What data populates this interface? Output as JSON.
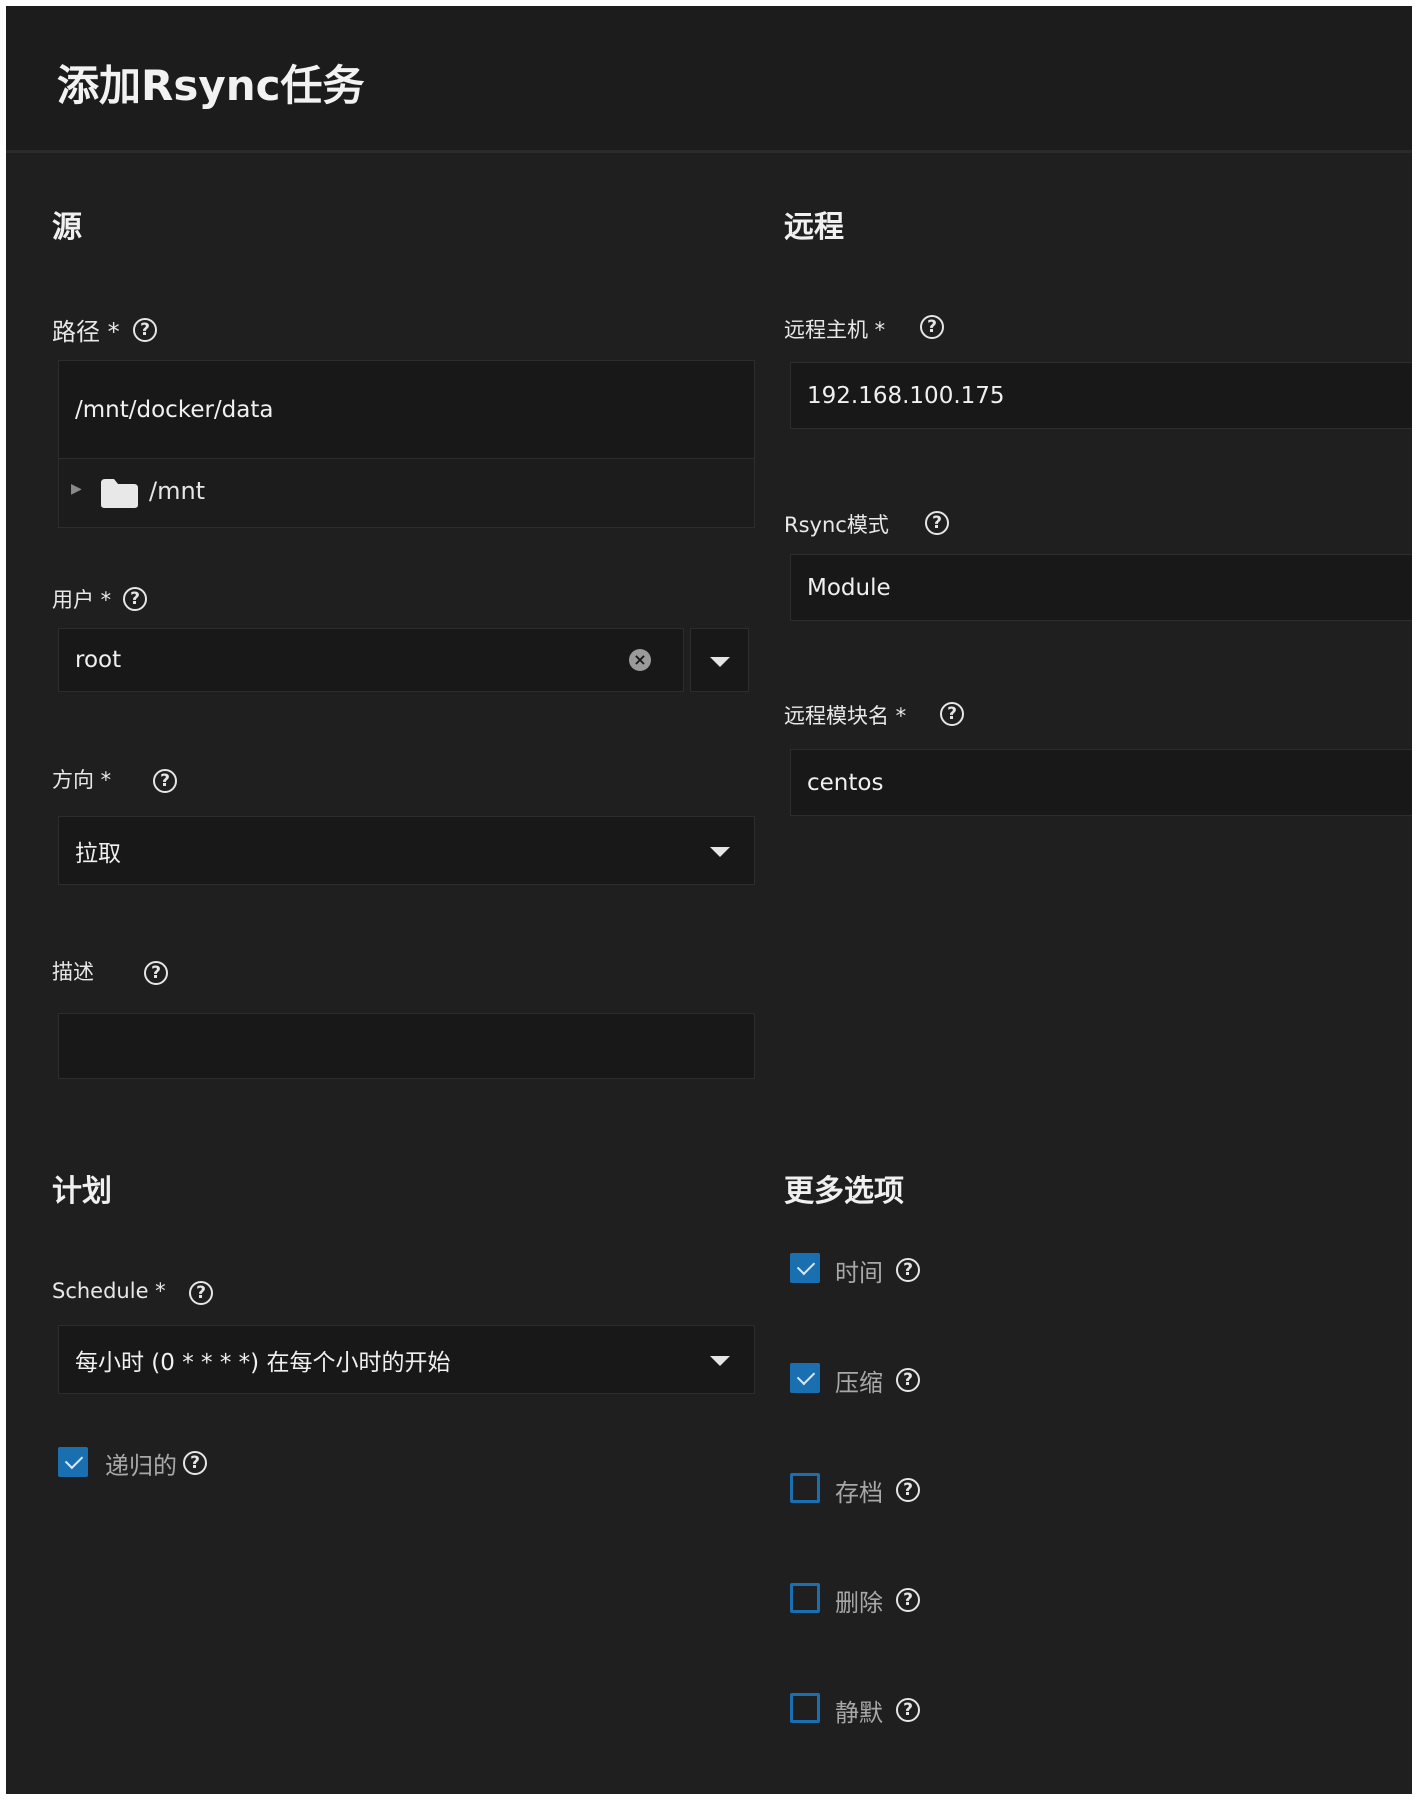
{
  "title": "添加Rsync任务",
  "source": {
    "heading": "源",
    "path": {
      "label": "路径 *",
      "value": "/mnt/docker/data",
      "tree_root": "/mnt"
    },
    "user": {
      "label": "用户 *",
      "value": "root"
    },
    "direction": {
      "label": "方向 *",
      "value": "拉取"
    },
    "description": {
      "label": "描述",
      "value": ""
    }
  },
  "remote": {
    "heading": "远程",
    "host": {
      "label": "远程主机 *",
      "value": "192.168.100.175"
    },
    "mode": {
      "label": "Rsync模式",
      "value": "Module"
    },
    "module": {
      "label": "远程模块名 *",
      "value": "centos"
    }
  },
  "schedule": {
    "heading": "计划",
    "label": "Schedule *",
    "value": "每小时 (0 * * * *) 在每个小时的开始",
    "recursive": {
      "label": "递归的",
      "checked": true
    }
  },
  "more": {
    "heading": "更多选项",
    "options": [
      {
        "label": "时间",
        "checked": true
      },
      {
        "label": "压缩",
        "checked": true
      },
      {
        "label": "存档",
        "checked": false
      },
      {
        "label": "删除",
        "checked": false
      },
      {
        "label": "静默",
        "checked": false
      }
    ]
  },
  "colors": {
    "accent": "#1a6fb0",
    "background": "#1f1f20",
    "field": "#181818"
  }
}
